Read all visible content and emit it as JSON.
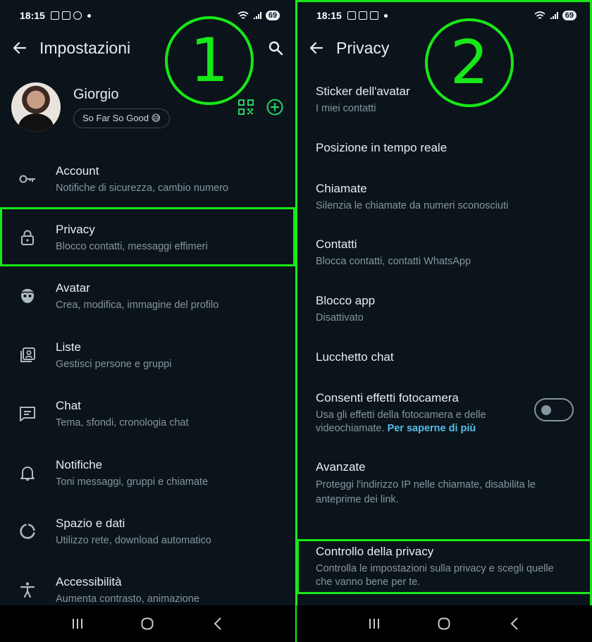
{
  "status_bar": {
    "time": "18:15",
    "battery": "69"
  },
  "left": {
    "title": "Impostazioni",
    "step": "1",
    "profile": {
      "name": "Giorgio",
      "status": "So Far So Good 😅"
    },
    "items": [
      {
        "title": "Account",
        "subtitle": "Notifiche di sicurezza, cambio numero",
        "icon": "key-icon"
      },
      {
        "title": "Privacy",
        "subtitle": "Blocco contatti, messaggi effimeri",
        "icon": "lock-icon"
      },
      {
        "title": "Avatar",
        "subtitle": "Crea, modifica, immagine del profilo",
        "icon": "avatar-face-icon"
      },
      {
        "title": "Liste",
        "subtitle": "Gestisci persone e gruppi",
        "icon": "contact-card-icon"
      },
      {
        "title": "Chat",
        "subtitle": "Tema, sfondi, cronologia chat",
        "icon": "chat-icon"
      },
      {
        "title": "Notifiche",
        "subtitle": "Toni messaggi, gruppi e chiamate",
        "icon": "bell-icon"
      },
      {
        "title": "Spazio e dati",
        "subtitle": "Utilizzo rete, download automatico",
        "icon": "data-usage-icon"
      },
      {
        "title": "Accessibilità",
        "subtitle": "Aumenta contrasto, animazione",
        "icon": "accessibility-icon"
      }
    ]
  },
  "right": {
    "title": "Privacy",
    "step": "2",
    "items": [
      {
        "title": "Sticker dell'avatar",
        "subtitle": "I miei contatti"
      },
      {
        "title": "Posizione in tempo reale",
        "subtitle": ""
      },
      {
        "title": "Chiamate",
        "subtitle": "Silenzia le chiamate da numeri sconosciuti"
      },
      {
        "title": "Contatti",
        "subtitle": "Blocca contatti, contatti WhatsApp"
      },
      {
        "title": "Blocco app",
        "subtitle": "Disattivato"
      },
      {
        "title": "Lucchetto chat",
        "subtitle": ""
      },
      {
        "title": "Consenti effetti fotocamera",
        "subtitle": "Usa gli effetti della fotocamera e delle videochiamate.",
        "link": "Per saperne di più",
        "toggle": false
      },
      {
        "title": "Avanzate",
        "subtitle": "Proteggi l'indirizzo IP nelle chiamate, disabilita le anteprime dei link."
      },
      {
        "title": "Controllo della privacy",
        "subtitle": "Controlla le impostazioni sulla privacy e scegli quelle che vanno bene per te."
      }
    ]
  },
  "colors": {
    "background": "#0b141a",
    "highlight": "#17e817",
    "accent": "#25d366",
    "link": "#53bdeb"
  }
}
